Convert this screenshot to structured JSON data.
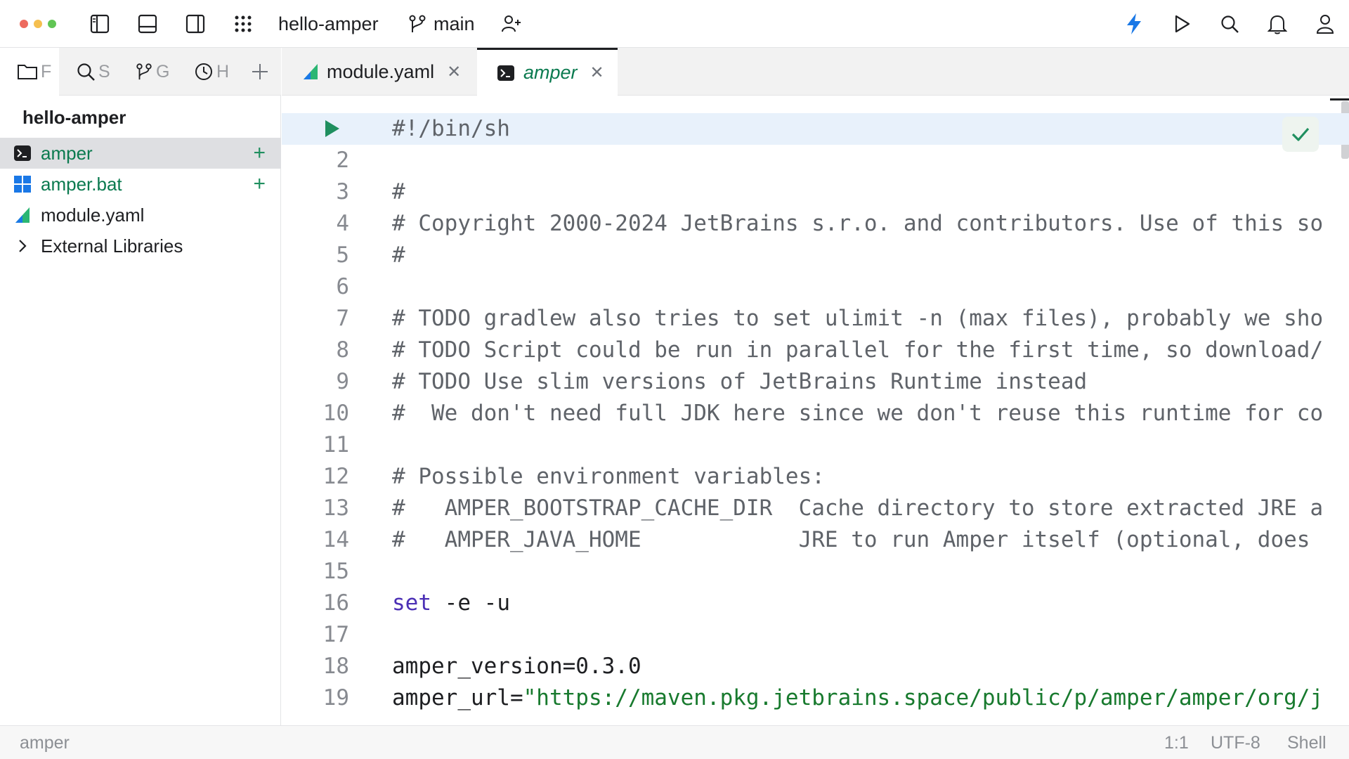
{
  "titlebar": {
    "project_name": "hello-amper",
    "branch": "main"
  },
  "left_tabs": [
    {
      "icon": "folder-icon",
      "label": "F"
    },
    {
      "icon": "search-icon",
      "label": "S"
    },
    {
      "icon": "branch-icon",
      "label": "G"
    },
    {
      "icon": "clock-icon",
      "label": "H"
    }
  ],
  "editor_tabs": [
    {
      "label": "module.yaml",
      "icon": "amper-yaml-icon",
      "active": false
    },
    {
      "label": "amper",
      "icon": "terminal-file-icon",
      "active": true
    }
  ],
  "project": {
    "title": "hello-amper",
    "items": [
      {
        "label": "amper",
        "icon": "terminal-file-icon",
        "color": "#0a7a4f",
        "selected": true,
        "added": "+"
      },
      {
        "label": "amper.bat",
        "icon": "windows-icon",
        "color": "#0a7a4f",
        "selected": false,
        "added": "+"
      },
      {
        "label": "module.yaml",
        "icon": "amper-yaml-icon",
        "color": "#1e1f22",
        "selected": false,
        "added": ""
      },
      {
        "label": "External Libraries",
        "icon": "chevron-right-icon",
        "color": "#1e1f22",
        "selected": false,
        "added": ""
      }
    ]
  },
  "editor": {
    "lines": [
      {
        "num": "",
        "text": "#!/bin/sh",
        "kind": "comment"
      },
      {
        "num": "2",
        "text": "",
        "kind": "plain"
      },
      {
        "num": "3",
        "text": "#",
        "kind": "comment"
      },
      {
        "num": "4",
        "text": "# Copyright 2000-2024 JetBrains s.r.o. and contributors. Use of this so",
        "kind": "comment"
      },
      {
        "num": "5",
        "text": "#",
        "kind": "comment"
      },
      {
        "num": "6",
        "text": "",
        "kind": "plain"
      },
      {
        "num": "7",
        "text": "# TODO gradlew also tries to set ulimit -n (max files), probably we sho",
        "kind": "comment"
      },
      {
        "num": "8",
        "text": "# TODO Script could be run in parallel for the first time, so download/",
        "kind": "comment"
      },
      {
        "num": "9",
        "text": "# TODO Use slim versions of JetBrains Runtime instead",
        "kind": "comment"
      },
      {
        "num": "10",
        "text": "#  We don't need full JDK here since we don't reuse this runtime for co",
        "kind": "comment"
      },
      {
        "num": "11",
        "text": "",
        "kind": "plain"
      },
      {
        "num": "12",
        "text": "# Possible environment variables:",
        "kind": "comment"
      },
      {
        "num": "13",
        "text": "#   AMPER_BOOTSTRAP_CACHE_DIR  Cache directory to store extracted JRE a",
        "kind": "comment"
      },
      {
        "num": "14",
        "text": "#   AMPER_JAVA_HOME            JRE to run Amper itself (optional, does",
        "kind": "comment"
      },
      {
        "num": "15",
        "text": "",
        "kind": "plain"
      },
      {
        "num": "16",
        "kw": "set",
        "text": " -e -u",
        "kind": "kw"
      },
      {
        "num": "17",
        "text": "",
        "kind": "plain"
      },
      {
        "num": "18",
        "text": "amper_version=0.3.0",
        "kind": "plain"
      },
      {
        "num": "19",
        "text": "amper_url=",
        "str": "\"https://maven.pkg.jetbrains.space/public/p/amper/amper/org/j",
        "kind": "str"
      }
    ]
  },
  "status": {
    "file": "amper",
    "position": "1:1",
    "encoding": "UTF-8",
    "language": "Shell"
  },
  "colors": {
    "accent": "#1a78e6",
    "added": "#1f8f5f",
    "run": "#1f8f5f"
  }
}
